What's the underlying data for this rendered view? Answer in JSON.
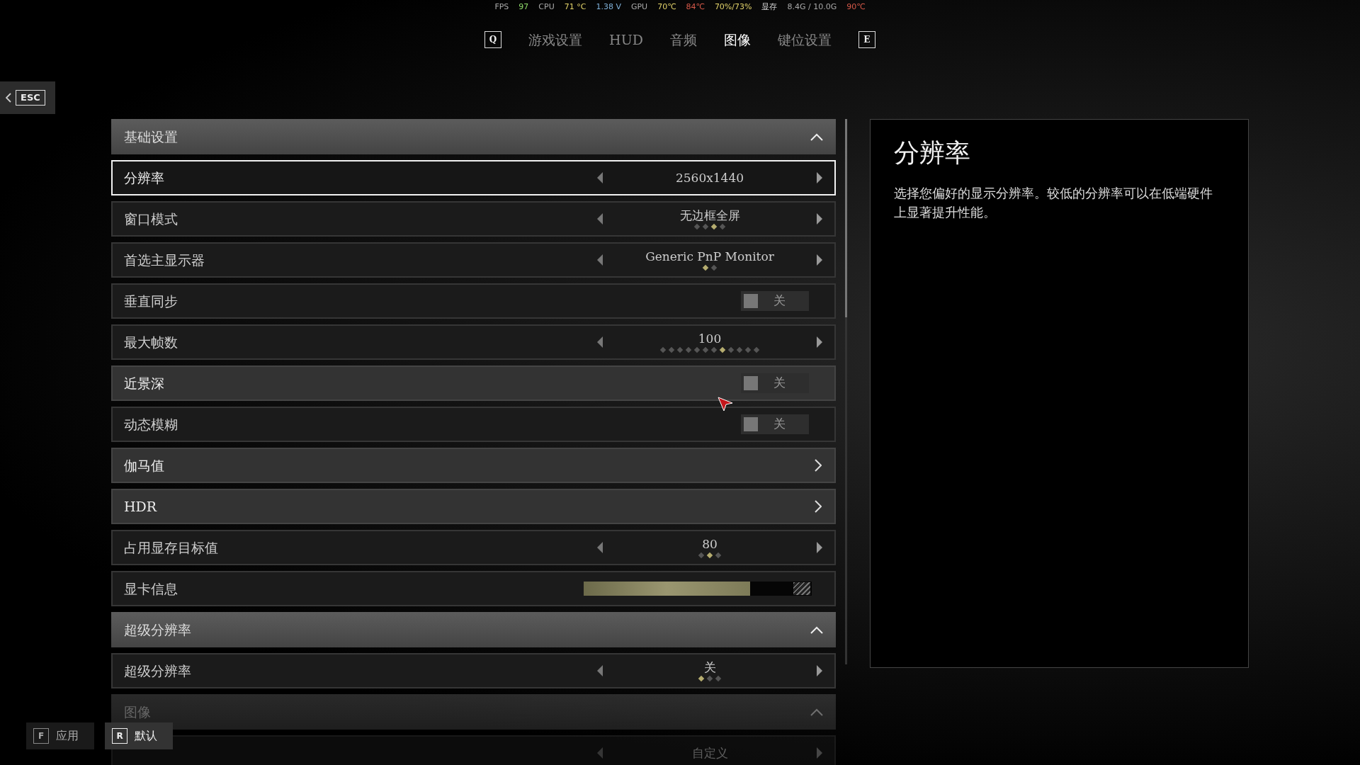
{
  "stats": [
    {
      "text": "FPS",
      "color": "#a8a8a8"
    },
    {
      "text": "97",
      "color": "#8fdc6a"
    },
    {
      "text": "CPU",
      "color": "#a8a8a8"
    },
    {
      "text": "71 °C",
      "color": "#e3d36a"
    },
    {
      "text": "1.38 V",
      "color": "#7fb0d8"
    },
    {
      "text": "GPU",
      "color": "#a8a8a8"
    },
    {
      "text": "70℃",
      "color": "#e3d36a"
    },
    {
      "text": "84℃",
      "color": "#d85a4a"
    },
    {
      "text": "70%/73%",
      "color": "#e3d36a"
    },
    {
      "text": "显存",
      "color": "#d0d0d0"
    },
    {
      "text": "8.4G / 10.0G",
      "color": "#a8a8a8"
    },
    {
      "text": "90℃",
      "color": "#d85a4a"
    }
  ],
  "tab_keys": [
    "Q",
    "E"
  ],
  "tabs": [
    {
      "label": "游戏设置",
      "selected": false
    },
    {
      "label": "HUD",
      "selected": false
    },
    {
      "label": "音频",
      "selected": false
    },
    {
      "label": "图像",
      "selected": true
    },
    {
      "label": "键位设置",
      "selected": false
    }
  ],
  "back_key": "ESC",
  "sections": [
    {
      "title": "基础设置",
      "expanded": true,
      "dimmed": false,
      "rows": [
        {
          "kind": "selector",
          "label": "分辨率",
          "value": "2560x1440",
          "selected": true,
          "highlighted": false,
          "dots": []
        },
        {
          "kind": "selector",
          "label": "窗口模式",
          "value": "无边框全屏",
          "selected": false,
          "highlighted": false,
          "dots": [
            {
              "selected": false
            },
            {
              "selected": false
            },
            {
              "selected": true
            },
            {
              "selected": false
            }
          ]
        },
        {
          "kind": "selector",
          "label": "首选主显示器",
          "value": "Generic PnP Monitor",
          "selected": false,
          "highlighted": false,
          "dots": [
            {
              "selected": true
            },
            {
              "selected": false
            }
          ]
        },
        {
          "kind": "toggle",
          "label": "垂直同步",
          "value": "关",
          "on": false,
          "selected": false,
          "highlighted": false
        },
        {
          "kind": "selector",
          "label": "最大帧数",
          "value": "100",
          "selected": false,
          "highlighted": false,
          "dots": [
            {
              "selected": false
            },
            {
              "selected": false
            },
            {
              "selected": false
            },
            {
              "selected": false
            },
            {
              "selected": false
            },
            {
              "selected": false
            },
            {
              "selected": false
            },
            {
              "selected": true
            },
            {
              "selected": false
            },
            {
              "selected": false
            },
            {
              "selected": false
            },
            {
              "selected": false
            }
          ]
        },
        {
          "kind": "toggle",
          "label": "近景深",
          "value": "关",
          "on": false,
          "selected": false,
          "highlighted": true
        },
        {
          "kind": "toggle",
          "label": "动态模糊",
          "value": "关",
          "on": false,
          "selected": false,
          "highlighted": false
        },
        {
          "kind": "link",
          "label": "伽马值",
          "selected": false,
          "highlighted": true
        },
        {
          "kind": "link",
          "label": "HDR",
          "selected": false,
          "highlighted": true
        },
        {
          "kind": "selector",
          "label": "占用显存目标值",
          "value": "80",
          "selected": false,
          "highlighted": false,
          "dots": [
            {
              "selected": false
            },
            {
              "selected": true
            },
            {
              "selected": false
            }
          ]
        },
        {
          "kind": "bar",
          "label": "显卡信息",
          "level": 0.73,
          "selected": false,
          "highlighted": false
        }
      ]
    },
    {
      "title": "超级分辨率",
      "expanded": true,
      "dimmed": false,
      "rows": [
        {
          "kind": "selector",
          "label": "超级分辨率",
          "value": "关",
          "selected": false,
          "highlighted": false,
          "dots": [
            {
              "selected": true
            },
            {
              "selected": false
            },
            {
              "selected": false
            }
          ]
        }
      ]
    },
    {
      "title": "图像",
      "expanded": true,
      "dimmed": true,
      "rows": [
        {
          "kind": "selector",
          "value": "自定义",
          "dots": []
        }
      ]
    }
  ],
  "detail": {
    "title": "分辨率",
    "text": "选择您偏好的显示分辨率。较低的分辨率可以在低端硬件上显著提升性能。"
  },
  "footer": [
    {
      "key": "F",
      "label": "应用",
      "selected": false
    },
    {
      "key": "R",
      "label": "默认",
      "selected": true
    }
  ]
}
